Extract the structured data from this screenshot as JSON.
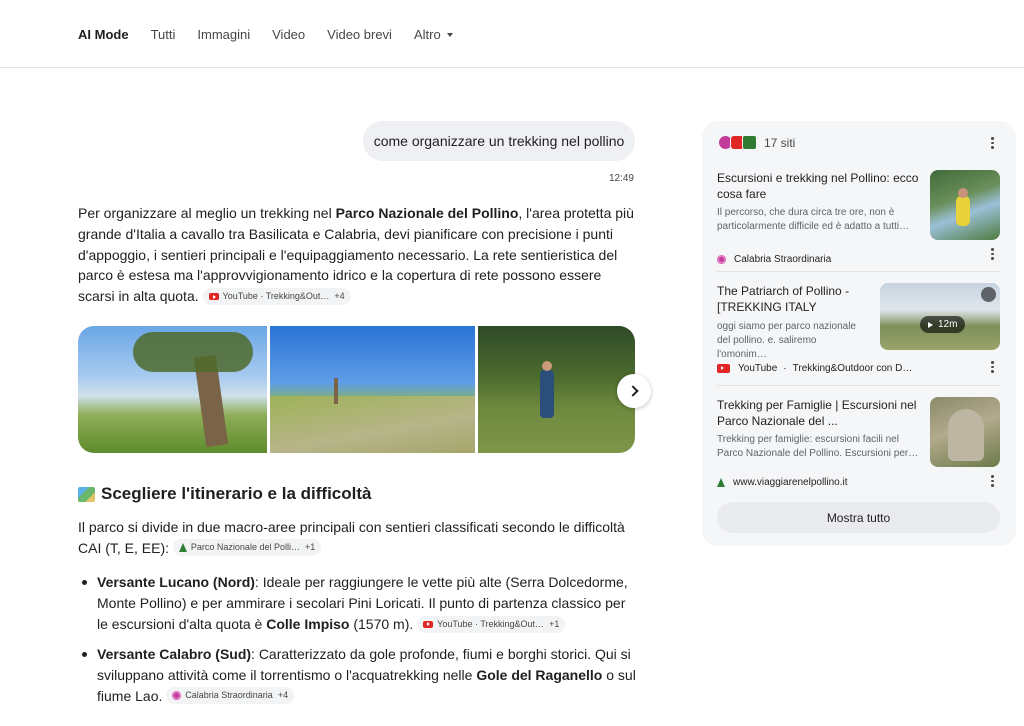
{
  "nav": {
    "tabs": [
      "AI Mode",
      "Tutti",
      "Immagini",
      "Video",
      "Video brevi",
      "Altro"
    ]
  },
  "query": {
    "text": "come organizzare un trekking nel pollino",
    "time": "12:49"
  },
  "answer": {
    "p1_a": "Per organizzare al meglio un trekking nel ",
    "p1_b": "Parco Nazionale del Pollino",
    "p1_c": ", l'area protetta più grande d'Italia a cavallo tra Basilicata e Calabria, devi pianificare con precisione i punti d'appoggio, i sentieri principali e l'equipaggiamento necessario. La rete sentieristica del parco è estesa ma l'approvvigionamento idrico e la copertura di rete possono essere scarsi in alta quota.",
    "chip1_label": "YouTube · Trekking&Out…",
    "chip1_more": "+4"
  },
  "section": {
    "heading": "Scegliere l'itinerario e la difficoltà",
    "intro": "Il parco si divide in due macro-aree principali con sentieri classificati secondo le difficoltà CAI (T, E, EE):",
    "chip_label": "Parco Nazionale del Polli…",
    "chip_more": "+1",
    "b1_title": "Versante Lucano (Nord)",
    "b1_a": ": Ideale per raggiungere le vette più alte (Serra Dolcedorme, Monte Pollino) e per ammirare i secolari Pini Loricati. Il punto di partenza classico per le escursioni d'alta quota è ",
    "b1_b": "Colle Impiso",
    "b1_c": " (1570 m).",
    "b1_chip": "YouTube · Trekking&Out…",
    "b1_more": "+1",
    "b2_title": "Versante Calabro (Sud)",
    "b2_a": ": Caratterizzato da gole profonde, fiumi e borghi storici. Qui si sviluppano attività come il torrentismo o l'acquatrekking nelle ",
    "b2_b": "Gole del Raganello",
    "b2_c": " o sul fiume Lao.",
    "b2_chip": "Calabria Straordinaria",
    "b2_more": "+4"
  },
  "panel": {
    "count": "17 siti",
    "cards": [
      {
        "title": "Escursioni e trekking nel Pollino: ecco cosa fare",
        "snippet": "Il percorso, che dura circa tre ore, non è particolarmente difficile ed è adatto a tutti…",
        "source": "Calabria Straordinaria",
        "icon": "flower-icon"
      },
      {
        "title": "The Patriarch of Pollino - [TREKKING ITALY",
        "snippet": "oggi siamo per parco nazionale del pollino. e. saliremo l'omonim…",
        "source": "YouTube",
        "source_extra": "Trekking&Outdoor con D…",
        "duration": "12m",
        "icon": "youtube-icon"
      },
      {
        "title": "Trekking per Famiglie | Escursioni nel Parco Nazionale del ...",
        "snippet": "Trekking per famiglie: escursioni facili nel Parco Nazionale del Pollino. Escursioni per…",
        "source": "www.viaggiarenelpollino.it",
        "icon": "tree-icon"
      }
    ],
    "show_all": "Mostra tutto"
  }
}
